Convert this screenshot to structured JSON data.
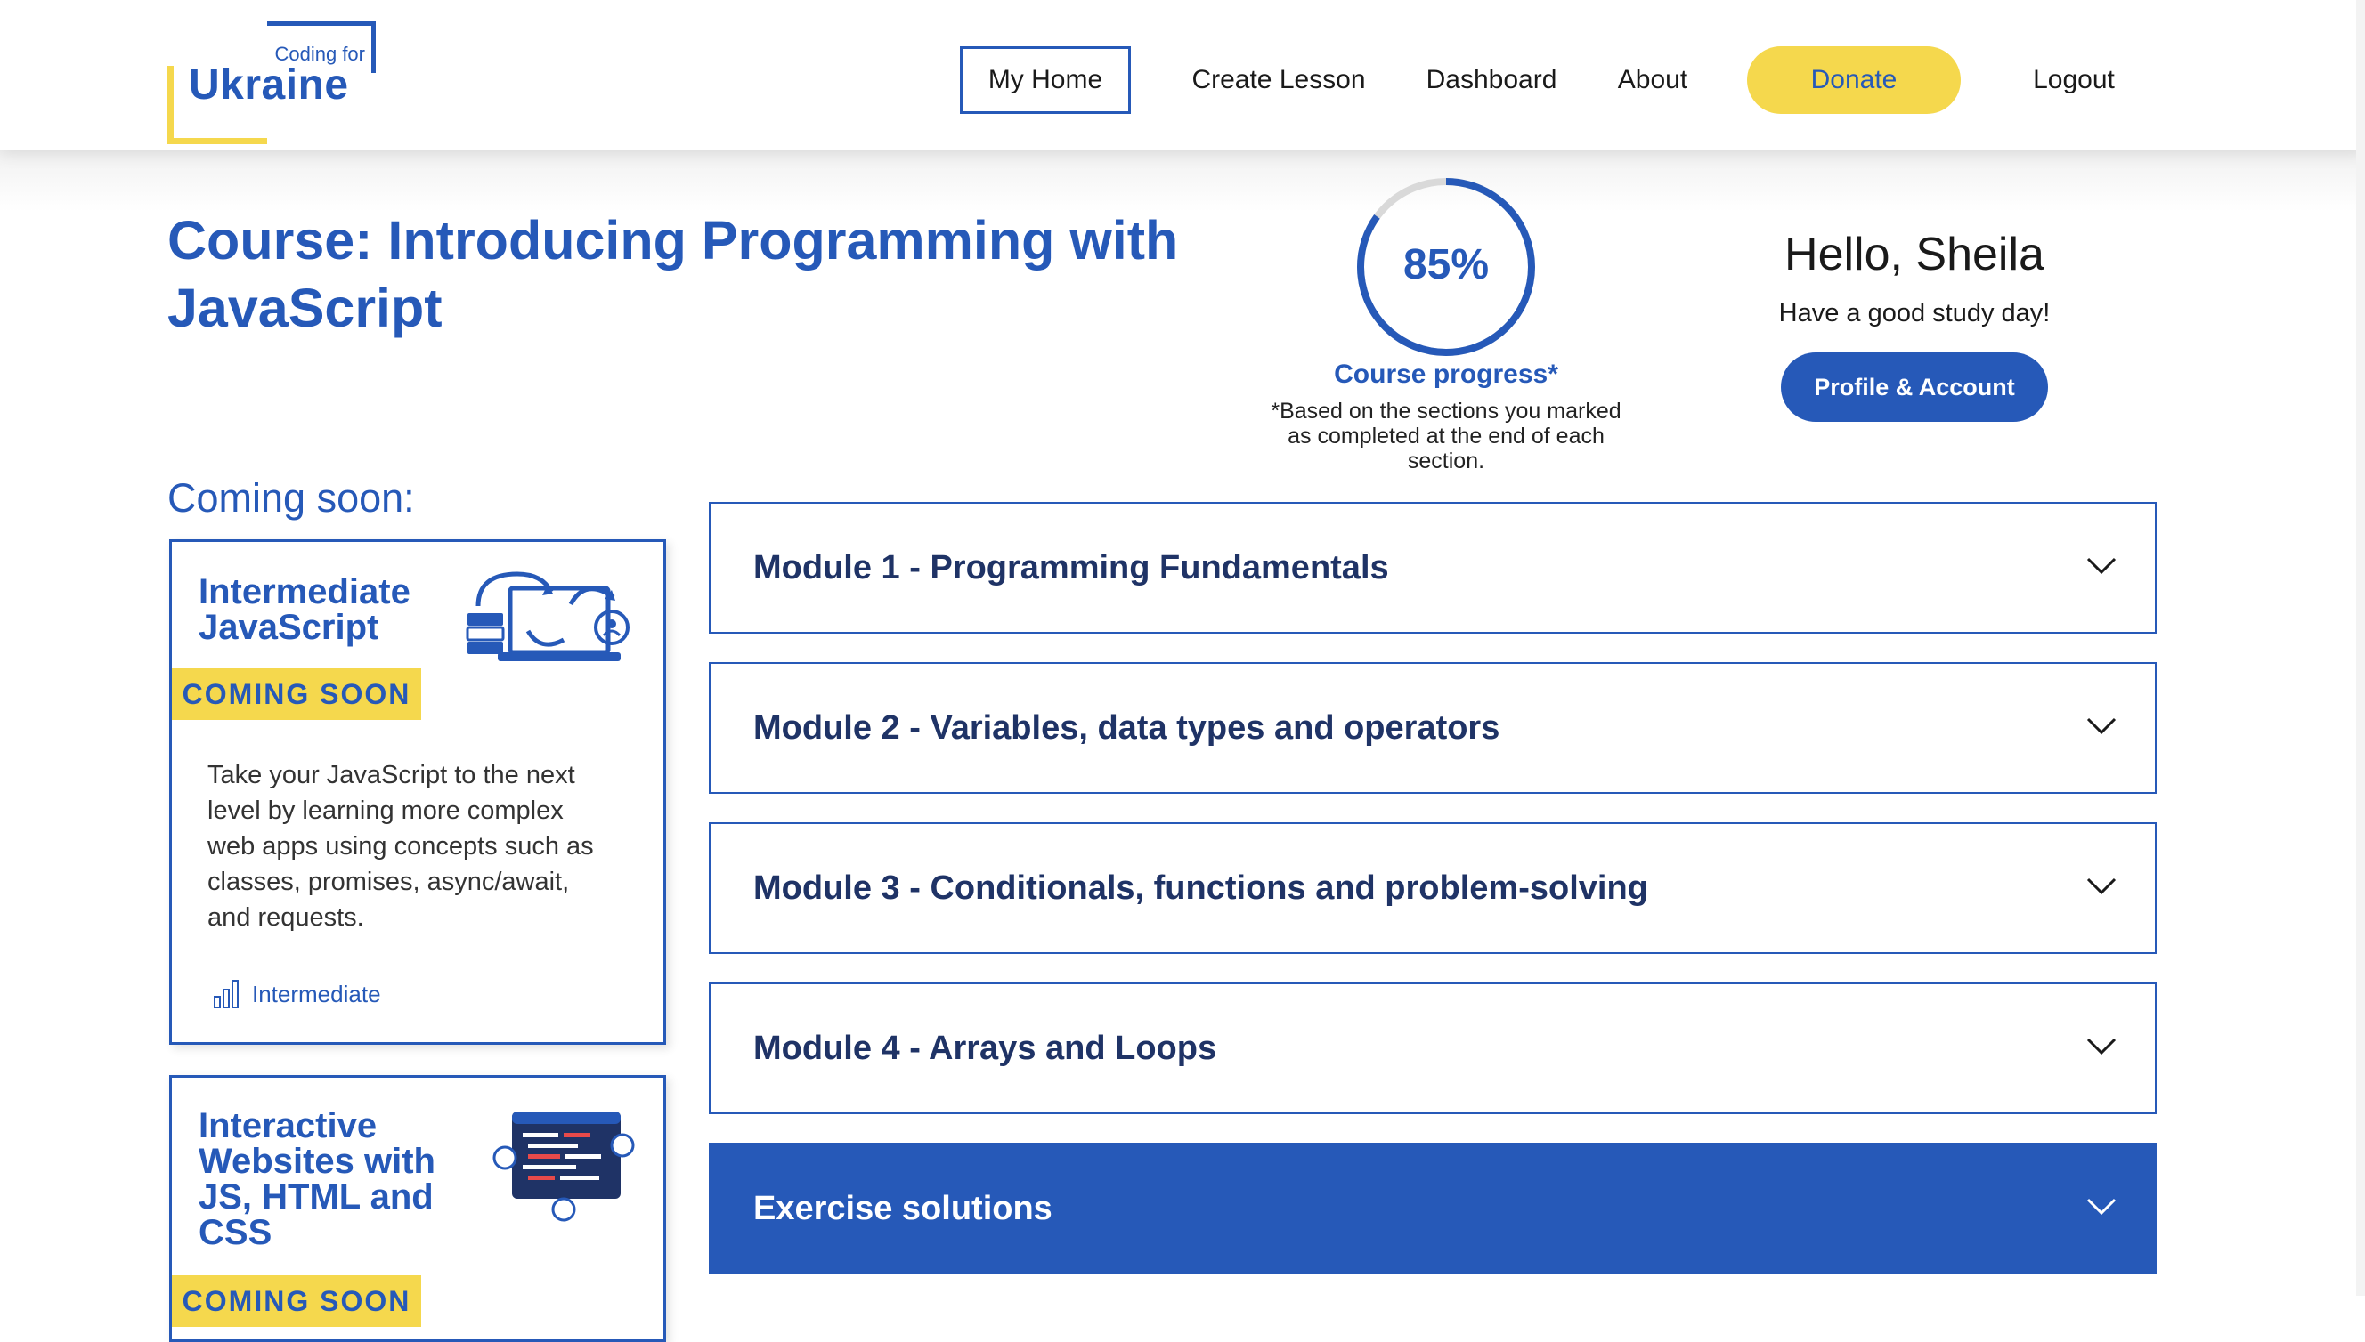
{
  "header": {
    "logo": {
      "small_text": "Coding for",
      "big_text": "Ukraine"
    },
    "nav": {
      "my_home": "My Home",
      "create_lesson": "Create Lesson",
      "dashboard": "Dashboard",
      "about": "About",
      "donate": "Donate",
      "logout": "Logout"
    }
  },
  "course": {
    "title": "Course: Introducing Programming with JavaScript"
  },
  "progress": {
    "percent": 85,
    "percent_label": "85%",
    "title": "Course progress*",
    "note": "*Based on the sections you marked as completed at the end of each section."
  },
  "user": {
    "greeting": "Hello, Sheila",
    "subgreeting": "Have a good study day!",
    "profile_button": "Profile & Account"
  },
  "coming_soon": {
    "heading": "Coming soon:",
    "cards": [
      {
        "title": "Intermediate JavaScript",
        "badge": "COMING SOON",
        "description": "Take your JavaScript to the next level by learning more complex web apps using concepts such as classes, promises, async/await, and requests.",
        "level": "Intermediate",
        "icon": "laptop-sync-icon"
      },
      {
        "title": "Interactive Websites with JS, HTML and CSS",
        "badge": "COMING SOON",
        "icon": "code-window-icon"
      }
    ]
  },
  "modules": [
    {
      "label": "Module 1 - Programming Fundamentals",
      "active": false
    },
    {
      "label": "Module 2 - Variables, data types and operators",
      "active": false
    },
    {
      "label": "Module 3 - Conditionals, functions and problem-solving",
      "active": false
    },
    {
      "label": "Module 4 - Arrays and Loops",
      "active": false
    },
    {
      "label": "Exercise solutions",
      "active": true
    }
  ],
  "colors": {
    "brand_blue": "#2659b8",
    "brand_yellow": "#f5d84d",
    "ring_track": "#d9d9d9"
  }
}
